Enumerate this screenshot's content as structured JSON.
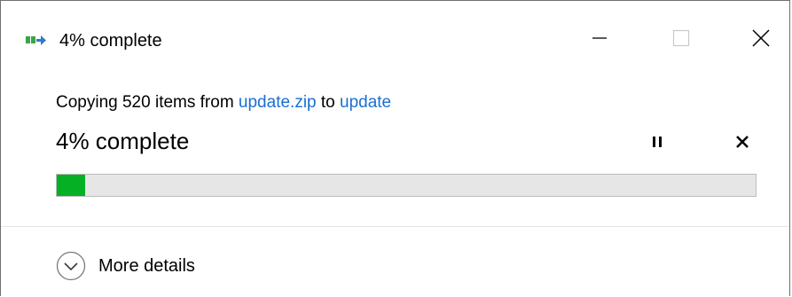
{
  "window": {
    "title": "4% complete",
    "app_icon": "file-copy-icon",
    "controls": {
      "minimize_icon": "minimize-icon",
      "maximize_icon": "maximize-icon",
      "close_icon": "close-icon"
    }
  },
  "operation": {
    "prefix": "Copying 520 items from ",
    "source": "update.zip",
    "connector": " to ",
    "destination": "update",
    "status": "4% complete",
    "progress_fraction": 0.04,
    "pause_icon": "pause-icon",
    "cancel_icon": "cancel-icon"
  },
  "footer": {
    "details_label": "More details",
    "details_icon": "chevron-down-circle-icon"
  },
  "colors": {
    "progress_fill": "#06b025",
    "progress_track": "#e6e6e6",
    "link": "#1a6fd1"
  }
}
